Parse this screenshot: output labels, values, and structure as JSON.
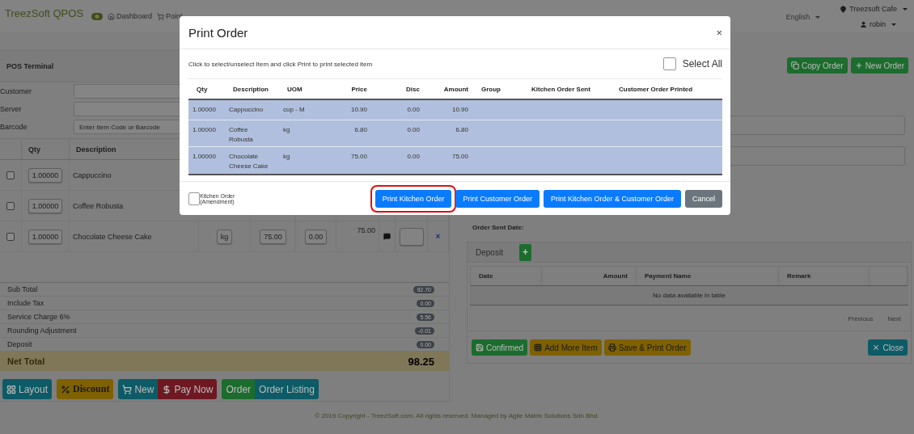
{
  "navbar": {
    "brand": "TreezSoft QPOS",
    "links": [
      {
        "label": "Dashboard"
      },
      {
        "label": "Point"
      }
    ],
    "language": "English",
    "outlet": "Treezsoft Cafe",
    "user": "robin"
  },
  "pos_terminal": {
    "title": "POS Terminal",
    "fields": [
      {
        "label": "Customer"
      },
      {
        "label": "Server"
      },
      {
        "label": "Barcode",
        "placeholder": "Enter Item Code or Barcode"
      }
    ],
    "items_table": {
      "columns": [
        "Qty",
        "Description"
      ],
      "rows": [
        {
          "checked": false,
          "qty": "1.00000",
          "description": "Cappuccino"
        },
        {
          "checked": false,
          "qty": "1.00000",
          "description": "Coffee Robusta"
        },
        {
          "checked": false,
          "qty": "1.00000",
          "description": "Chocolate Cheese Cake",
          "uom": "kg",
          "price": "75.00",
          "disc": "0.00",
          "amount": "75.00",
          "remove": "×"
        }
      ]
    },
    "summary": [
      {
        "label": "Sub Total",
        "value": "92.70"
      },
      {
        "label": "Include Tax",
        "value": "0.00"
      },
      {
        "label": "Service Charge 6%",
        "value": "5.56"
      },
      {
        "label": "Rounding Adjustment",
        "value": "-0.01"
      },
      {
        "label": "Deposit",
        "value": "0.00"
      }
    ],
    "net_total": {
      "label": "Net Total",
      "value": "98.25"
    },
    "buttons": [
      {
        "label": "Layout",
        "kind": "info"
      },
      {
        "label": "Discount",
        "kind": "warning"
      },
      {
        "label": "New",
        "kind": "info"
      },
      {
        "label": "Pay Now",
        "kind": "danger"
      },
      {
        "label": "Order",
        "kind": "success"
      },
      {
        "label": "Order Listing",
        "kind": "info"
      }
    ]
  },
  "order_panel": {
    "actions": [
      {
        "label": "Copy Order"
      },
      {
        "label": "New Order"
      }
    ],
    "order_sent_date": "Order Sent Date:",
    "deposit": {
      "title": "Deposit",
      "add": "+",
      "columns": [
        "Date",
        "Amount",
        "Payment Name",
        "Remark"
      ],
      "empty_message": "No data available in table",
      "pagination": [
        "Previous",
        "Next"
      ]
    },
    "buttons": [
      {
        "label": "Confirmed",
        "kind": "success"
      },
      {
        "label": "Add More Item",
        "kind": "warning"
      },
      {
        "label": "Save & Print Order",
        "kind": "warning"
      },
      {
        "label": "Close",
        "kind": "info"
      }
    ]
  },
  "modal": {
    "title": "Print Order",
    "close": "×",
    "instruction": "Click to select/unselect Item and click Print to print selected item",
    "select_all": {
      "label": "Select All",
      "checked": false
    },
    "columns": [
      "Qty",
      "Description",
      "UOM",
      "Price",
      "Disc",
      "Amount",
      "Group",
      "Kitchen Order Sent",
      "Customer Order Printed"
    ],
    "rows": [
      {
        "selected": true,
        "cells": [
          "1.00000",
          "Cappuccino",
          "cup - M",
          "10.90",
          "0.00",
          "10.90"
        ]
      },
      {
        "selected": true,
        "cells": [
          "1.00000",
          "Coffee Robusta",
          "kg",
          "6.80",
          "0.00",
          "6.80"
        ]
      },
      {
        "selected": true,
        "cells": [
          "1.00000",
          "Chocolate Cheese Cake",
          "kg",
          "75.00",
          "0.00",
          "75.00"
        ]
      }
    ],
    "amendment": {
      "label": "Kitchen Order (Amendment)",
      "checked": false
    },
    "buttons": [
      {
        "label": "Print Kitchen Order",
        "kind": "primary",
        "highlighted": true
      },
      {
        "label": "Print Customer Order",
        "kind": "primary",
        "highlighted": false
      },
      {
        "label": "Print Kitchen Order & Customer Order",
        "kind": "primary",
        "highlighted": false
      },
      {
        "label": "Cancel",
        "kind": "secondary",
        "highlighted": false
      }
    ]
  },
  "footer": "© 2019 Copyright - TreezSoft.com. All rights reserved. Managed by Agile Matrix Solutions Sdn Bhd."
}
